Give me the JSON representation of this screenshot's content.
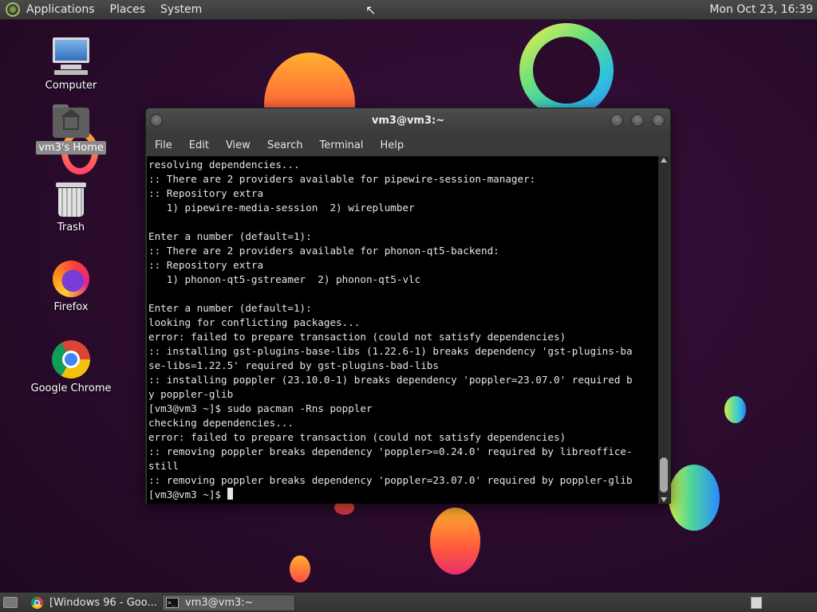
{
  "top_panel": {
    "menus": [
      "Applications",
      "Places",
      "System"
    ],
    "clock": "Mon Oct 23, 16:39"
  },
  "desktop": {
    "icons": [
      {
        "label": "Computer",
        "icon": "computer-icon"
      },
      {
        "label": "vm3's Home",
        "icon": "home-folder-icon",
        "selected": true
      },
      {
        "label": "Trash",
        "icon": "trash-icon"
      },
      {
        "label": "Firefox",
        "icon": "firefox-icon"
      },
      {
        "label": "Google Chrome",
        "icon": "chrome-icon"
      }
    ]
  },
  "terminal": {
    "title": "vm3@vm3:~",
    "menu": [
      "File",
      "Edit",
      "View",
      "Search",
      "Terminal",
      "Help"
    ],
    "lines": [
      "resolving dependencies...",
      ":: There are 2 providers available for pipewire-session-manager:",
      ":: Repository extra",
      "   1) pipewire-media-session  2) wireplumber",
      "",
      "Enter a number (default=1):",
      ":: There are 2 providers available for phonon-qt5-backend:",
      ":: Repository extra",
      "   1) phonon-qt5-gstreamer  2) phonon-qt5-vlc",
      "",
      "Enter a number (default=1):",
      "looking for conflicting packages...",
      "error: failed to prepare transaction (could not satisfy dependencies)",
      ":: installing gst-plugins-base-libs (1.22.6-1) breaks dependency 'gst-plugins-ba",
      "se-libs=1.22.5' required by gst-plugins-bad-libs",
      ":: installing poppler (23.10.0-1) breaks dependency 'poppler=23.07.0' required b",
      "y poppler-glib",
      "[vm3@vm3 ~]$ sudo pacman -Rns poppler",
      "checking dependencies...",
      "error: failed to prepare transaction (could not satisfy dependencies)",
      ":: removing poppler breaks dependency 'poppler>=0.24.0' required by libreoffice-",
      "still",
      ":: removing poppler breaks dependency 'poppler=23.07.0' required by poppler-glib"
    ],
    "prompt": "[vm3@vm3 ~]$ "
  },
  "taskbar": {
    "tasks": [
      {
        "label": "[Windows 96 - Goo...",
        "icon": "chrome-icon",
        "active": false
      },
      {
        "label": "vm3@vm3:~",
        "icon": "terminal-icon",
        "active": true
      }
    ]
  },
  "colors": {
    "panel": "#3c3c3c",
    "terminal_bg": "#000000",
    "terminal_fg": "#e6e6e6",
    "wallpaper": "#2a0b2c"
  }
}
